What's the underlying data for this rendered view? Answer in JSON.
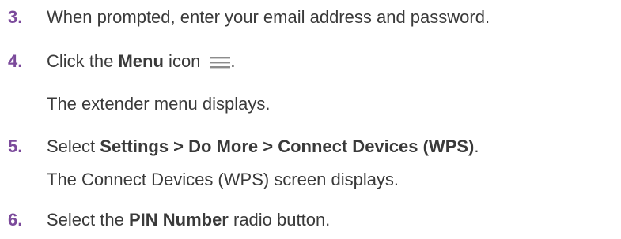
{
  "steps": [
    {
      "number": "3.",
      "text": "When prompted, enter your email address and password."
    },
    {
      "number": "4.",
      "before": "Click the ",
      "bold": "Menu",
      "after": " icon",
      "icon": "menu-icon",
      "end": ".",
      "note": "The extender menu displays."
    },
    {
      "number": "5.",
      "before": "Select ",
      "bold": "Settings > Do More > Connect Devices (WPS)",
      "end": ".",
      "note": "The Connect Devices (WPS) screen displays."
    },
    {
      "number": "6.",
      "before": "Select the ",
      "bold": "PIN Number",
      "after": " radio button."
    }
  ],
  "colors": {
    "step_number": "#7b4a9b",
    "body_text": "#3a3a3a",
    "icon": "#8c8c8c"
  }
}
